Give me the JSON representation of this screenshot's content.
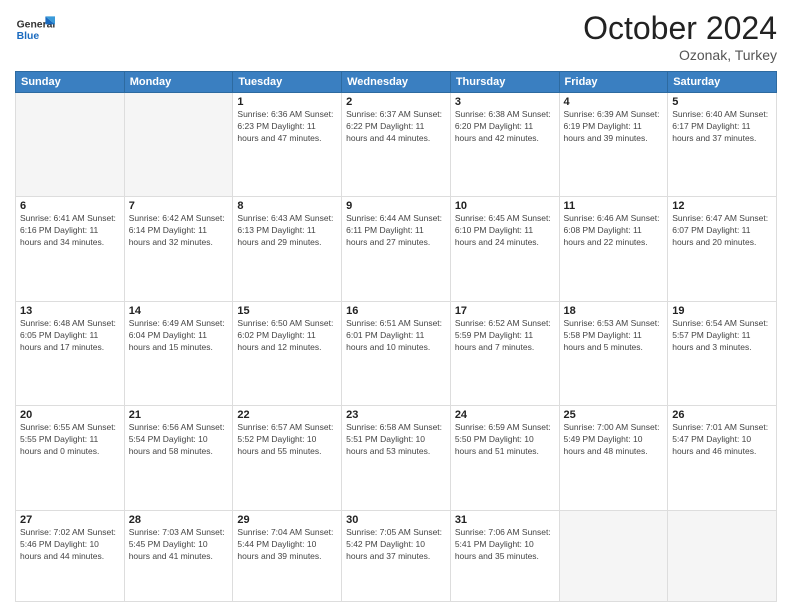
{
  "header": {
    "logo_general": "General",
    "logo_blue": "Blue",
    "month_title": "October 2024",
    "location": "Ozonak, Turkey"
  },
  "days_of_week": [
    "Sunday",
    "Monday",
    "Tuesday",
    "Wednesday",
    "Thursday",
    "Friday",
    "Saturday"
  ],
  "weeks": [
    [
      {
        "day": "",
        "info": ""
      },
      {
        "day": "",
        "info": ""
      },
      {
        "day": "1",
        "info": "Sunrise: 6:36 AM\nSunset: 6:23 PM\nDaylight: 11 hours and 47 minutes."
      },
      {
        "day": "2",
        "info": "Sunrise: 6:37 AM\nSunset: 6:22 PM\nDaylight: 11 hours and 44 minutes."
      },
      {
        "day": "3",
        "info": "Sunrise: 6:38 AM\nSunset: 6:20 PM\nDaylight: 11 hours and 42 minutes."
      },
      {
        "day": "4",
        "info": "Sunrise: 6:39 AM\nSunset: 6:19 PM\nDaylight: 11 hours and 39 minutes."
      },
      {
        "day": "5",
        "info": "Sunrise: 6:40 AM\nSunset: 6:17 PM\nDaylight: 11 hours and 37 minutes."
      }
    ],
    [
      {
        "day": "6",
        "info": "Sunrise: 6:41 AM\nSunset: 6:16 PM\nDaylight: 11 hours and 34 minutes."
      },
      {
        "day": "7",
        "info": "Sunrise: 6:42 AM\nSunset: 6:14 PM\nDaylight: 11 hours and 32 minutes."
      },
      {
        "day": "8",
        "info": "Sunrise: 6:43 AM\nSunset: 6:13 PM\nDaylight: 11 hours and 29 minutes."
      },
      {
        "day": "9",
        "info": "Sunrise: 6:44 AM\nSunset: 6:11 PM\nDaylight: 11 hours and 27 minutes."
      },
      {
        "day": "10",
        "info": "Sunrise: 6:45 AM\nSunset: 6:10 PM\nDaylight: 11 hours and 24 minutes."
      },
      {
        "day": "11",
        "info": "Sunrise: 6:46 AM\nSunset: 6:08 PM\nDaylight: 11 hours and 22 minutes."
      },
      {
        "day": "12",
        "info": "Sunrise: 6:47 AM\nSunset: 6:07 PM\nDaylight: 11 hours and 20 minutes."
      }
    ],
    [
      {
        "day": "13",
        "info": "Sunrise: 6:48 AM\nSunset: 6:05 PM\nDaylight: 11 hours and 17 minutes."
      },
      {
        "day": "14",
        "info": "Sunrise: 6:49 AM\nSunset: 6:04 PM\nDaylight: 11 hours and 15 minutes."
      },
      {
        "day": "15",
        "info": "Sunrise: 6:50 AM\nSunset: 6:02 PM\nDaylight: 11 hours and 12 minutes."
      },
      {
        "day": "16",
        "info": "Sunrise: 6:51 AM\nSunset: 6:01 PM\nDaylight: 11 hours and 10 minutes."
      },
      {
        "day": "17",
        "info": "Sunrise: 6:52 AM\nSunset: 5:59 PM\nDaylight: 11 hours and 7 minutes."
      },
      {
        "day": "18",
        "info": "Sunrise: 6:53 AM\nSunset: 5:58 PM\nDaylight: 11 hours and 5 minutes."
      },
      {
        "day": "19",
        "info": "Sunrise: 6:54 AM\nSunset: 5:57 PM\nDaylight: 11 hours and 3 minutes."
      }
    ],
    [
      {
        "day": "20",
        "info": "Sunrise: 6:55 AM\nSunset: 5:55 PM\nDaylight: 11 hours and 0 minutes."
      },
      {
        "day": "21",
        "info": "Sunrise: 6:56 AM\nSunset: 5:54 PM\nDaylight: 10 hours and 58 minutes."
      },
      {
        "day": "22",
        "info": "Sunrise: 6:57 AM\nSunset: 5:52 PM\nDaylight: 10 hours and 55 minutes."
      },
      {
        "day": "23",
        "info": "Sunrise: 6:58 AM\nSunset: 5:51 PM\nDaylight: 10 hours and 53 minutes."
      },
      {
        "day": "24",
        "info": "Sunrise: 6:59 AM\nSunset: 5:50 PM\nDaylight: 10 hours and 51 minutes."
      },
      {
        "day": "25",
        "info": "Sunrise: 7:00 AM\nSunset: 5:49 PM\nDaylight: 10 hours and 48 minutes."
      },
      {
        "day": "26",
        "info": "Sunrise: 7:01 AM\nSunset: 5:47 PM\nDaylight: 10 hours and 46 minutes."
      }
    ],
    [
      {
        "day": "27",
        "info": "Sunrise: 7:02 AM\nSunset: 5:46 PM\nDaylight: 10 hours and 44 minutes."
      },
      {
        "day": "28",
        "info": "Sunrise: 7:03 AM\nSunset: 5:45 PM\nDaylight: 10 hours and 41 minutes."
      },
      {
        "day": "29",
        "info": "Sunrise: 7:04 AM\nSunset: 5:44 PM\nDaylight: 10 hours and 39 minutes."
      },
      {
        "day": "30",
        "info": "Sunrise: 7:05 AM\nSunset: 5:42 PM\nDaylight: 10 hours and 37 minutes."
      },
      {
        "day": "31",
        "info": "Sunrise: 7:06 AM\nSunset: 5:41 PM\nDaylight: 10 hours and 35 minutes."
      },
      {
        "day": "",
        "info": ""
      },
      {
        "day": "",
        "info": ""
      }
    ]
  ]
}
